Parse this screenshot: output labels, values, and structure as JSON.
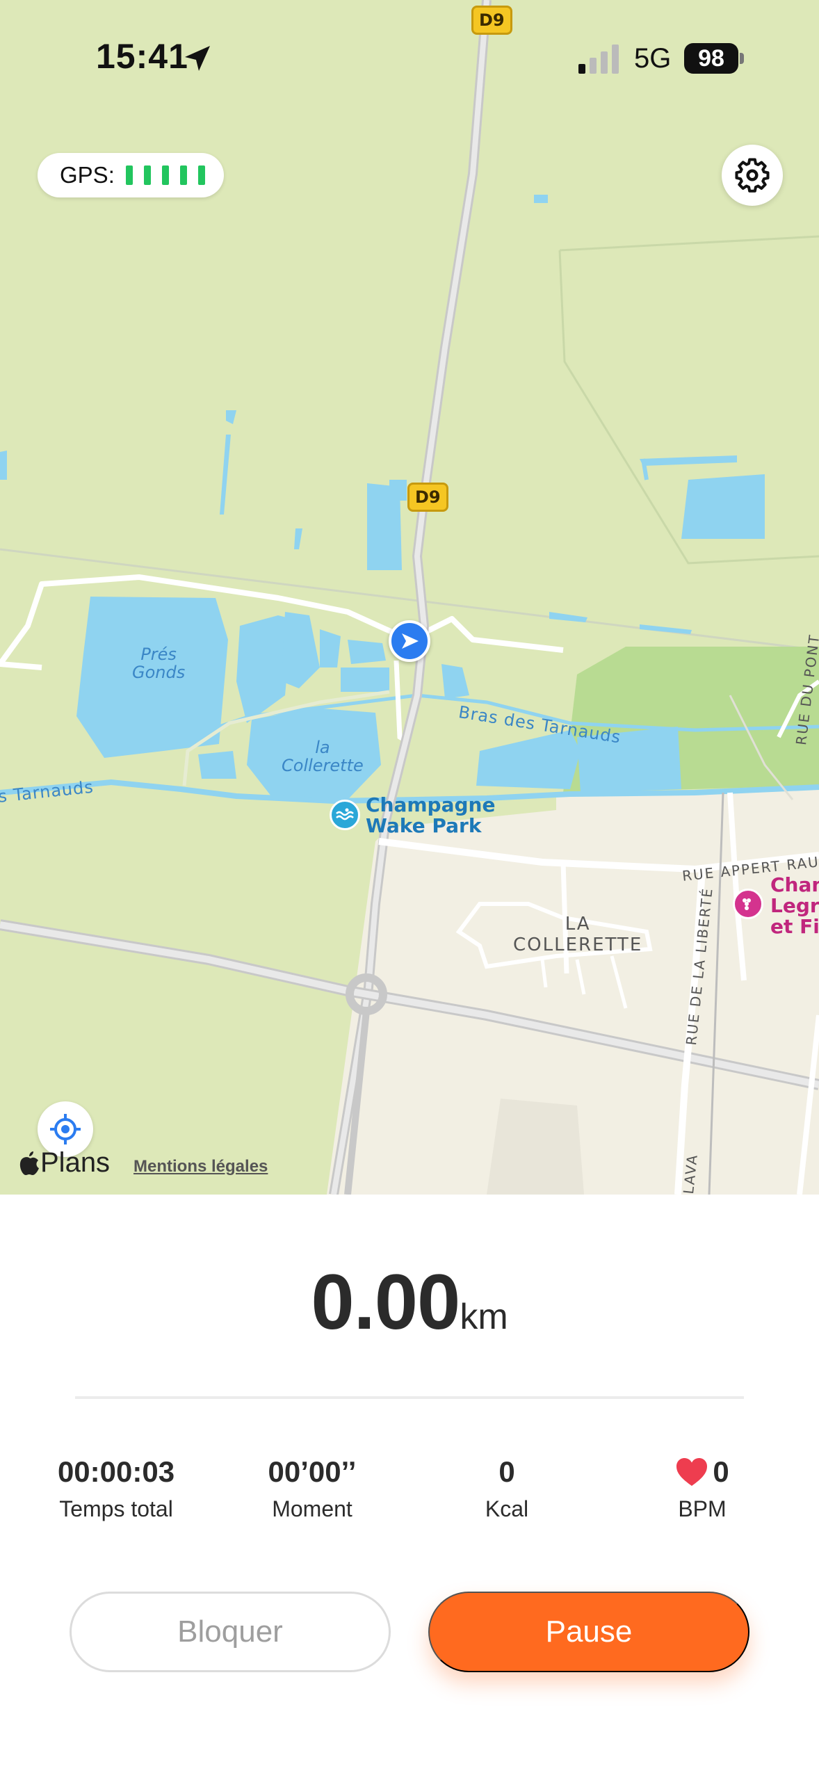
{
  "status_bar": {
    "time": "15:41",
    "network": "5G",
    "battery": "98"
  },
  "gps": {
    "label": "GPS:",
    "bars": 5
  },
  "map": {
    "road_badge": "D9",
    "water": {
      "pres_gonds": [
        "Prés",
        "Gonds"
      ],
      "collerette": [
        "la",
        "Collerette"
      ]
    },
    "channel_right": "Bras des Tarnauds",
    "channel_left": "s Tarnauds",
    "poi": [
      "Champagne",
      "Wake Park"
    ],
    "place": [
      "LA",
      "COLLERETTE"
    ],
    "streets": {
      "appert": "RUE APPERT RAUL",
      "pont": "RUE DU PONT",
      "liberte": "RUE DE LA LIBERTÉ",
      "lava": "LAVA"
    },
    "winery": [
      "Cham",
      "Legra",
      "et Fil"
    ],
    "brand": "Plans",
    "legal": "Mentions légales"
  },
  "workout": {
    "distance": "0.00",
    "unit": "km",
    "stats": [
      {
        "value": "00:00:03",
        "label": "Temps total"
      },
      {
        "value": "00’00’’",
        "label": "Moment"
      },
      {
        "value": "0",
        "label": "Kcal"
      },
      {
        "value": "0",
        "label": "BPM"
      }
    ]
  },
  "buttons": {
    "lock": "Bloquer",
    "pause": "Pause"
  },
  "colors": {
    "accent": "#ff6a1f",
    "gps_bar": "#22c55e",
    "heart": "#ee3d4f",
    "user_marker": "#2b7cf0"
  }
}
